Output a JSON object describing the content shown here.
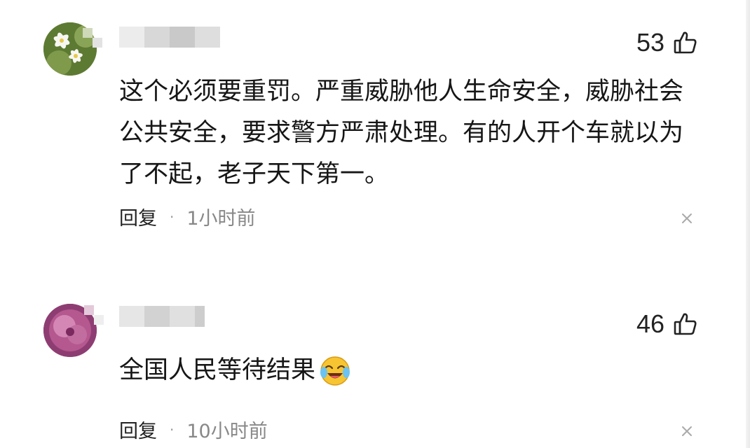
{
  "comments": [
    {
      "likes": "53",
      "text": "这个必须要重罚。严重威胁他人生命安全，威胁社会公共安全，要求警方严肃处理。有的人开个车就以为了不起，老子天下第一。",
      "reply_label": "回复",
      "separator": "·",
      "time": "1小时前"
    },
    {
      "likes": "46",
      "text": "全国人民等待结果",
      "reply_label": "回复",
      "separator": "·",
      "time": "10小时前"
    }
  ],
  "icons": {
    "like": "thumbs-up-icon",
    "close": "close-icon",
    "emoji": "crying-laughing-emoji-icon"
  },
  "colors": {
    "text": "#161616",
    "meta": "#888888",
    "background": "#ffffff"
  }
}
